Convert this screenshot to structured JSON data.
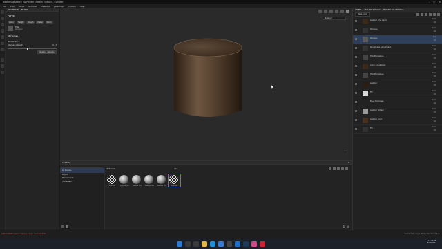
{
  "window": {
    "title": "Adobe Substance 3D Painter (Steam Edition) - Cylinder"
  },
  "menu": [
    "File",
    "Edit",
    "Mode",
    "Window",
    "Viewport",
    "JavaScript",
    "Python",
    "Help"
  ],
  "properties": {
    "header": "PROPERTIES - FILTER",
    "section_filter": "FILTER",
    "channels": [
      "Color",
      "Height",
      "Rough",
      "Metal",
      "Norm"
    ],
    "filter_label": "Filter",
    "filter_value": "Sharpen",
    "section_attributes": "Attributes",
    "section_parameters": "Parameters",
    "param_label": "Sharpen intensity",
    "param_value": "0.17",
    "reset_label": "Restore defaults"
  },
  "viewport": {
    "mode_label": "Material"
  },
  "assets": {
    "header": "ASSETS",
    "search_placeholder": "Search in All libraries",
    "breadcrumb": "All libraries",
    "query": "mix",
    "libraries": [
      "All libraries",
      "Project",
      "Starter assets",
      "Your assets"
    ],
    "items": [
      {
        "label": "Sharpen",
        "kind": "checker"
      },
      {
        "label": "Leather Mix",
        "kind": "sphere"
      },
      {
        "label": "Leather Mix",
        "kind": "sphere"
      },
      {
        "label": "Leather Mix",
        "kind": "sphere"
      },
      {
        "label": "Leather Mix",
        "kind": "sphere"
      },
      {
        "label": "Sharpen",
        "kind": "checker"
      }
    ]
  },
  "layers_panel": {
    "tabs": [
      "LAYERS",
      "TEXTURE SET LIST",
      "TEXTURE SET SETTINGS"
    ],
    "channel": "Base color",
    "layers": [
      {
        "name": "Leather Fine Aged",
        "mode": "Norm",
        "opacity": "100",
        "thumb": "#3a2a1c"
      },
      {
        "name": "Sharpen",
        "mode": "Norm",
        "opacity": "100",
        "thumb": "#333333"
      },
      {
        "name": "Sharpen",
        "mode": "Repl",
        "opacity": "100",
        "thumb": "#5a5a5a",
        "selected": true
      },
      {
        "name": "Roughness Adjustment",
        "mode": "Norm",
        "opacity": "100",
        "thumb": "#333333"
      },
      {
        "name": "HSL Perceptive",
        "mode": "Norm",
        "opacity": "100",
        "thumb": "#444444"
      },
      {
        "name": "Color adjustment",
        "mode": "Norm",
        "opacity": "100",
        "thumb": "#3a2a1c"
      },
      {
        "name": "HSL Perceptive",
        "mode": "Norm",
        "opacity": "100",
        "thumb": "#444444"
      },
      {
        "name": "Leather",
        "mode": "Norm",
        "opacity": "100",
        "thumb": "#2b1d12"
      },
      {
        "name": "Fill",
        "mode": "Norm",
        "opacity": "100",
        "thumb": "#d9d9d9"
      },
      {
        "name": "Base Damages",
        "mode": "Norm",
        "opacity": "100",
        "thumb": "#222222"
      },
      {
        "name": "Leather Pattern",
        "mode": "Norm",
        "opacity": "100",
        "thumb": "#999999"
      },
      {
        "name": "Leather Color",
        "mode": "Norm",
        "opacity": "100",
        "thumb": "#4a3220"
      },
      {
        "name": "Fill",
        "mode": "Norm",
        "opacity": "100",
        "thumb": "#333333"
      }
    ]
  },
  "status": {
    "left": "[GPU] VRAM: Cache memory usage reached limit",
    "right": "Cache disk usage: 37% | Version: 9.1.2"
  },
  "taskbar": {
    "time": "12:40 PM",
    "date": "8/29/2024",
    "icons": [
      "start",
      "search",
      "widgets",
      "explorer",
      "edge",
      "store",
      "terminal",
      "mail",
      "steam",
      "painter",
      "substance"
    ],
    "colors": [
      "#2b7bd3",
      "#3a3a3a",
      "#3a3a3a",
      "#e5b64a",
      "#1e8fd6",
      "#3a7bd5",
      "#444444",
      "#1f6fc5",
      "#1a3a5a",
      "#d04a8a",
      "#c23"
    ]
  }
}
